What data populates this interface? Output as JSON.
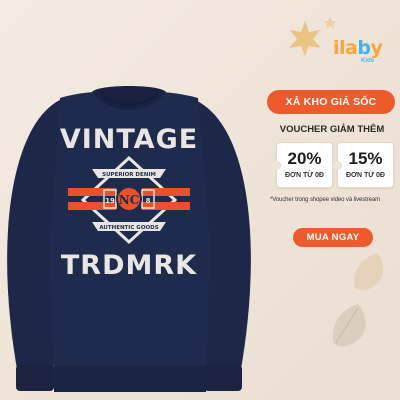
{
  "brand": {
    "logo_main": "ilaby",
    "logo_sub": "Kids"
  },
  "shirt_print": {
    "top_word": "VINTAGE",
    "bottom_word": "TRDMRK",
    "monogram": "NC",
    "ribbon_top": "SUPERIOR DENIM",
    "ribbon_bottom": "AUTHENTIC GOODS",
    "left_box": "19",
    "right_box": "8",
    "color_print": "#e8e6e0",
    "color_accent": "#e8512a",
    "color_fabric": "#1e2a4c"
  },
  "promo": {
    "headline": "XẢ KHO GIÁ SỐC",
    "voucher_title": "VOUCHER GIẢM THÊM",
    "coupons": [
      {
        "percent": "20%",
        "from": "ĐƠN TỪ 0Đ"
      },
      {
        "percent": "15%",
        "from": "ĐƠN TỪ 0Đ"
      }
    ],
    "note": "*Voucher trong shopee video và livestream",
    "cta": "MUA NGAY",
    "accent_color": "#ed5a2b"
  }
}
